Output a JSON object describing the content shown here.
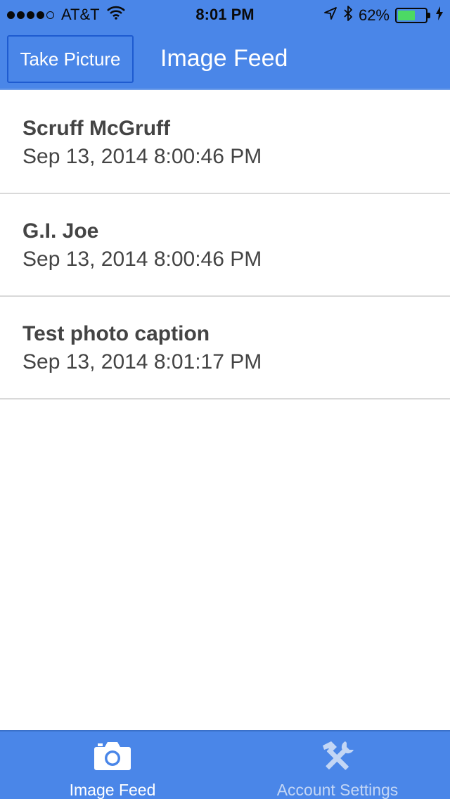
{
  "status_bar": {
    "carrier": "AT&T",
    "time": "8:01 PM",
    "battery_percent": "62%",
    "battery_level": 0.62,
    "icons": [
      "signal-dots-icon",
      "wifi-icon",
      "location-arrow-icon",
      "bluetooth-icon",
      "battery-icon",
      "charging-bolt-icon"
    ]
  },
  "nav_bar": {
    "left_button": "Take Picture",
    "title": "Image Feed"
  },
  "feed": {
    "items": [
      {
        "title": "Scruff McGruff",
        "date": "Sep 13, 2014 8:00:46 PM"
      },
      {
        "title": "G.I. Joe",
        "date": "Sep 13, 2014 8:00:46 PM"
      },
      {
        "title": "Test photo caption",
        "date": "Sep 13, 2014 8:01:17 PM"
      }
    ]
  },
  "tab_bar": {
    "tabs": [
      {
        "label": "Image Feed",
        "icon": "camera-icon",
        "selected": true
      },
      {
        "label": "Account Settings",
        "icon": "tools-icon",
        "selected": false
      }
    ]
  },
  "colors": {
    "accent": "#4a86e8",
    "text": "#444444",
    "divider": "#d9d9d9",
    "battery": "#4cd964"
  }
}
